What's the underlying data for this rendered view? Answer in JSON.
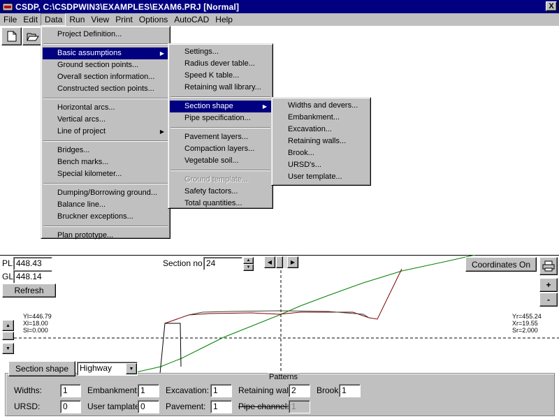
{
  "window": {
    "title": "CSDP, C:\\CSDPWIN3\\EXAMPLES\\EXAM6.PRJ [Normal]",
    "close_glyph": "X"
  },
  "menubar": [
    "File",
    "Edit",
    "Data",
    "Run",
    "View",
    "Print",
    "Options",
    "AutoCAD",
    "Help"
  ],
  "data_menu": [
    "Project Definition...",
    "Basic assumptions",
    "Ground section points...",
    "Overall section information...",
    "Constructed section points...",
    "Horizontal arcs...",
    "Vertical arcs...",
    "Line of project",
    "Bridges...",
    "Bench marks...",
    "Special kilometer...",
    "Dumping/Borrowing ground...",
    "Balance line...",
    "Bruckner exceptions...",
    "Plan prototype..."
  ],
  "basic_assumptions_menu": [
    "Settings...",
    "Radius dever table...",
    "Speed K table...",
    "Retaining wall library...",
    "Section shape",
    "Pipe specification...",
    "Pavement layers...",
    "Compaction layers...",
    "Vegetable soil...",
    "Ground template...",
    "Safety factors...",
    "Total quantities..."
  ],
  "section_shape_menu": [
    "Widths and devers...",
    "Embankment...",
    "Excavation...",
    "Retaining walls...",
    "Brook...",
    "URSD's...",
    "User template..."
  ],
  "section": {
    "pl_label": "PL:",
    "pl_value": "448.43",
    "gl_label": "GL:",
    "gl_value": "448.14",
    "refresh": "Refresh",
    "section_no_label": "Section no.:",
    "section_no": "24",
    "coordinates_btn": "Coordinates On",
    "zoom_in": "+",
    "zoom_out": "-",
    "left_info": [
      "Yl=446.79",
      "Xl=18.00",
      "Sl=0.000"
    ],
    "right_info": [
      "Yr=455.24",
      "Xr=19.55",
      "Sr=2.000"
    ],
    "section_shape_btn": "Section shape",
    "shape_type": "Highway"
  },
  "patterns": {
    "title": "Patterns",
    "widths_label": "Widths:",
    "widths": "1",
    "embankment_label": "Embankment:",
    "embankment": "1",
    "excavation_label": "Excavation:",
    "excavation": "1",
    "retaining_wall_label": "Retaining wall:",
    "retaining_wall": "2",
    "brook_label": "Brook",
    "brook": "1",
    "ursd_label": "URSD:",
    "ursd": "0",
    "user_template_label": "User tamplate:",
    "user_template": "0",
    "pavement_label": "Pavement:",
    "pavement": "1",
    "pipe_channel_label": "Pipe channel:",
    "pipe_channel": "1"
  },
  "colors": {
    "titlebar": "#000080",
    "menu_highlight": "#000080",
    "ground_line": "#008000",
    "section_line": "#800000"
  }
}
